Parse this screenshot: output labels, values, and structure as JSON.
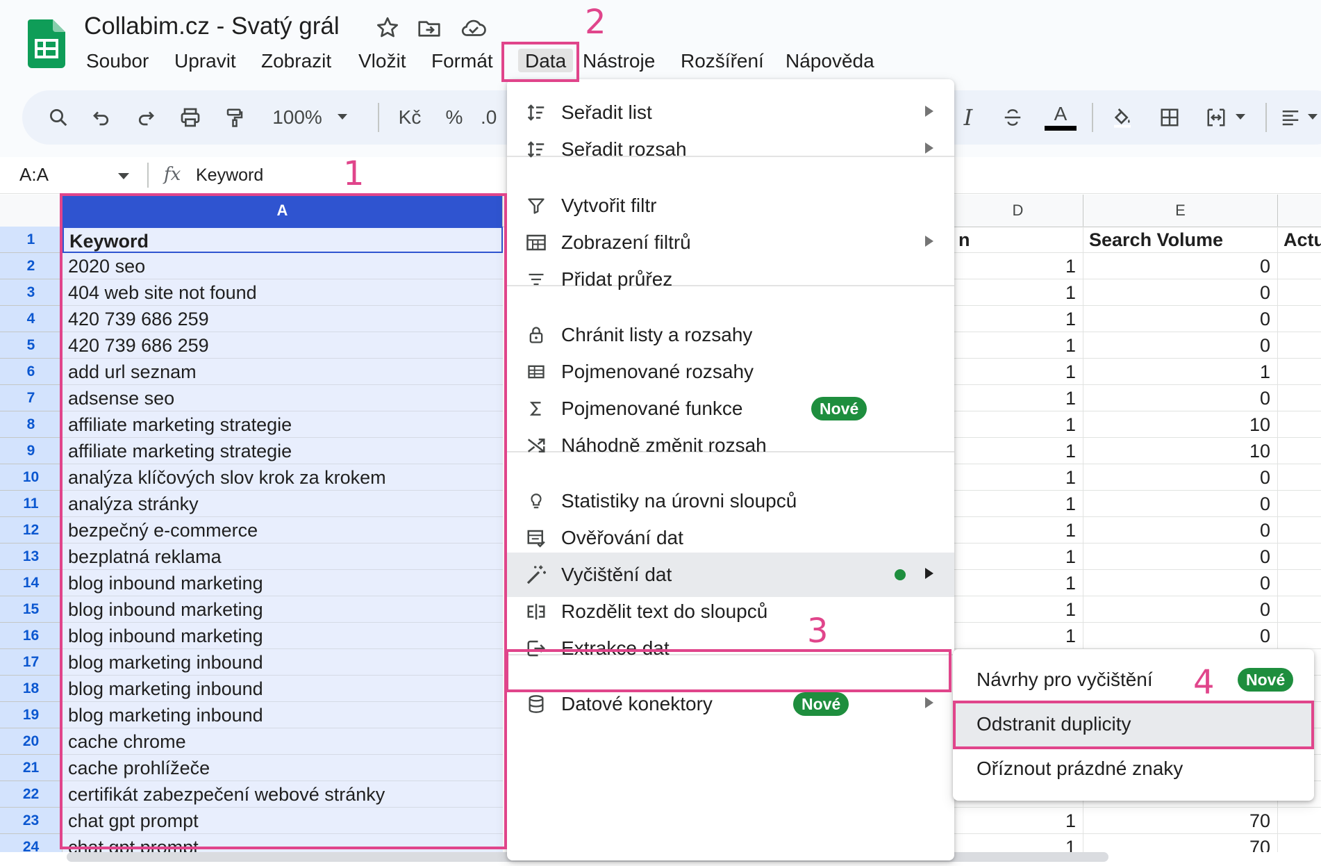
{
  "app": {
    "title": "Collabim.cz - Svatý grál",
    "icons": [
      "star-icon",
      "move-to-folder-icon",
      "cloud-saved-icon"
    ]
  },
  "menubar": {
    "items": [
      "Soubor",
      "Upravit",
      "Zobrazit",
      "Vložit",
      "Formát",
      "Data",
      "Nástroje",
      "Rozšíření",
      "Nápověda"
    ],
    "active": "Data"
  },
  "toolbar": {
    "zoom": "100%",
    "currency": "Kč",
    "percent": "%",
    "decimal": ".0",
    "text_color_letter": "A"
  },
  "formula_bar": {
    "name_box": "A:A",
    "fx": "fx",
    "value": "Keyword"
  },
  "grid": {
    "columns": [
      "A",
      "D",
      "E"
    ],
    "header": {
      "a": "Keyword",
      "d": "n",
      "e": "Search Volume",
      "f": "Actu"
    },
    "rows": [
      {
        "n": "2",
        "a": "2020 seo",
        "d": "1",
        "e": "0"
      },
      {
        "n": "3",
        "a": "404 web site not found",
        "d": "1",
        "e": "0"
      },
      {
        "n": "4",
        "a": "420 739 686 259",
        "d": "1",
        "e": "0"
      },
      {
        "n": "5",
        "a": "420 739 686 259",
        "d": "1",
        "e": "0"
      },
      {
        "n": "6",
        "a": "add url seznam",
        "d": "1",
        "e": "1"
      },
      {
        "n": "7",
        "a": "adsense seo",
        "d": "1",
        "e": "0"
      },
      {
        "n": "8",
        "a": "affiliate marketing strategie",
        "d": "1",
        "e": "10"
      },
      {
        "n": "9",
        "a": "affiliate marketing strategie",
        "d": "1",
        "e": "10"
      },
      {
        "n": "10",
        "a": "analýza klíčových slov krok za krokem",
        "d": "1",
        "e": "0"
      },
      {
        "n": "11",
        "a": "analýza stránky",
        "d": "1",
        "e": "0"
      },
      {
        "n": "12",
        "a": "bezpečný e-commerce",
        "d": "1",
        "e": "0"
      },
      {
        "n": "13",
        "a": "bezplatná reklama",
        "d": "1",
        "e": "0"
      },
      {
        "n": "14",
        "a": "blog inbound marketing",
        "d": "1",
        "e": "0"
      },
      {
        "n": "15",
        "a": "blog inbound marketing",
        "d": "1",
        "e": "0"
      },
      {
        "n": "16",
        "a": "blog inbound marketing",
        "d": "1",
        "e": "0"
      },
      {
        "n": "17",
        "a": "blog marketing inbound",
        "d": "",
        "e": ""
      },
      {
        "n": "18",
        "a": "blog marketing inbound",
        "d": "",
        "e": ""
      },
      {
        "n": "19",
        "a": "blog marketing inbound",
        "d": "",
        "e": ""
      },
      {
        "n": "20",
        "a": "cache chrome",
        "d": "",
        "e": ""
      },
      {
        "n": "21",
        "a": "cache prohlížeče",
        "d": "",
        "e": ""
      },
      {
        "n": "22",
        "a": "certifikát zabezpečení webové stránky",
        "d": "",
        "e": ""
      },
      {
        "n": "23",
        "a": "chat gpt prompt",
        "d": "1",
        "e": "70"
      },
      {
        "n": "24",
        "a": "chat gpt prompt",
        "d": "1",
        "e": "70"
      }
    ]
  },
  "data_menu": {
    "items": [
      {
        "label": "Seřadit list",
        "icon": "sort-icon",
        "submenu": true
      },
      {
        "label": "Seřadit rozsah",
        "icon": "sort-icon",
        "submenu": true
      },
      {
        "label": "Vytvořit filtr",
        "icon": "filter-icon"
      },
      {
        "label": "Zobrazení filtrů",
        "icon": "filter-views-icon",
        "submenu": true
      },
      {
        "label": "Přidat průřez",
        "icon": "slicer-icon"
      },
      {
        "label": "Chránit listy a rozsahy",
        "icon": "lock-icon"
      },
      {
        "label": "Pojmenované rozsahy",
        "icon": "named-ranges-icon"
      },
      {
        "label": "Pojmenované funkce",
        "icon": "sigma-icon",
        "badge": "Nové"
      },
      {
        "label": "Náhodně změnit rozsah",
        "icon": "shuffle-icon"
      },
      {
        "label": "Statistiky na úrovni sloupců",
        "icon": "lightbulb-icon"
      },
      {
        "label": "Ověřování dat",
        "icon": "data-validation-icon"
      },
      {
        "label": "Vyčištění dat",
        "icon": "magic-wand-icon",
        "submenu": true,
        "dot": true
      },
      {
        "label": "Rozdělit text do sloupců",
        "icon": "split-columns-icon"
      },
      {
        "label": "Extrakce dat",
        "icon": "extract-icon"
      },
      {
        "label": "Datové konektory",
        "icon": "database-icon",
        "badge": "Nové",
        "submenu": true
      }
    ]
  },
  "cleanup_submenu": {
    "items": [
      {
        "label": "Návrhy pro vyčištění",
        "badge": "Nové"
      },
      {
        "label": "Odstranit duplicity"
      },
      {
        "label": "Oříznout prázdné znaky"
      }
    ]
  },
  "annotations": [
    "1",
    "2",
    "3",
    "4"
  ],
  "colors": {
    "accent": "#2f54d0",
    "selection": "#e8eefd",
    "annotation": "#e0458b",
    "badge_green": "#1e8e3e"
  }
}
